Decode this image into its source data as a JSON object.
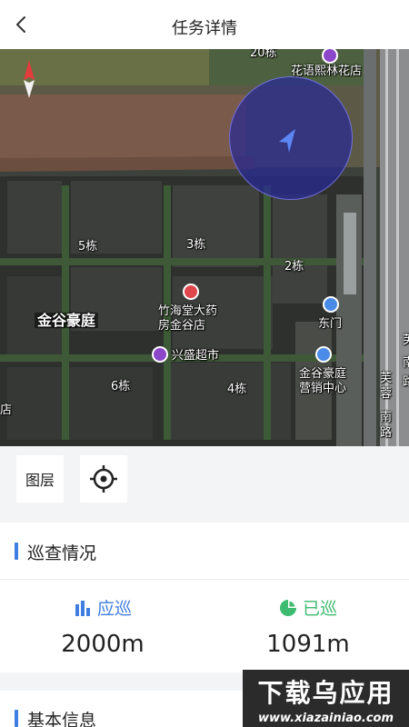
{
  "header": {
    "title": "任务详情"
  },
  "map": {
    "labels": {
      "b20": "20栋",
      "flower_shop": "花语熙林花店",
      "b5": "5栋",
      "b3": "3栋",
      "b2": "2栋",
      "pharmacy_1": "竹海堂大药",
      "pharmacy_2": "房金谷店",
      "east_gate": "东门",
      "community": "金谷豪庭",
      "supermarket": "兴盛超市",
      "sales_1": "金谷豪庭",
      "sales_2": "营销中心",
      "b6": "6栋",
      "b4": "4栋",
      "edge_left": "店",
      "road_1": "芙",
      "road_2": "蓉",
      "road_3": "南",
      "road_4": "路",
      "road_right_1": "芙",
      "road_right_2": "南",
      "road_right_3": "路"
    }
  },
  "tools": {
    "layers_label": "图层"
  },
  "patrol": {
    "title": "巡查情况",
    "planned_label": "应巡",
    "planned_value": "2000m",
    "done_label": "已巡",
    "done_value": "1091m"
  },
  "basic": {
    "title": "基本信息"
  },
  "watermark": {
    "line1": "下载乌应用",
    "line2": "www.xiazainiao.com"
  },
  "colors": {
    "accent": "#3f7de0",
    "done": "#3dbb6e",
    "poi_purple": "#8b46c9",
    "poi_red": "#e0474c",
    "poi_blue": "#4a8be8"
  }
}
